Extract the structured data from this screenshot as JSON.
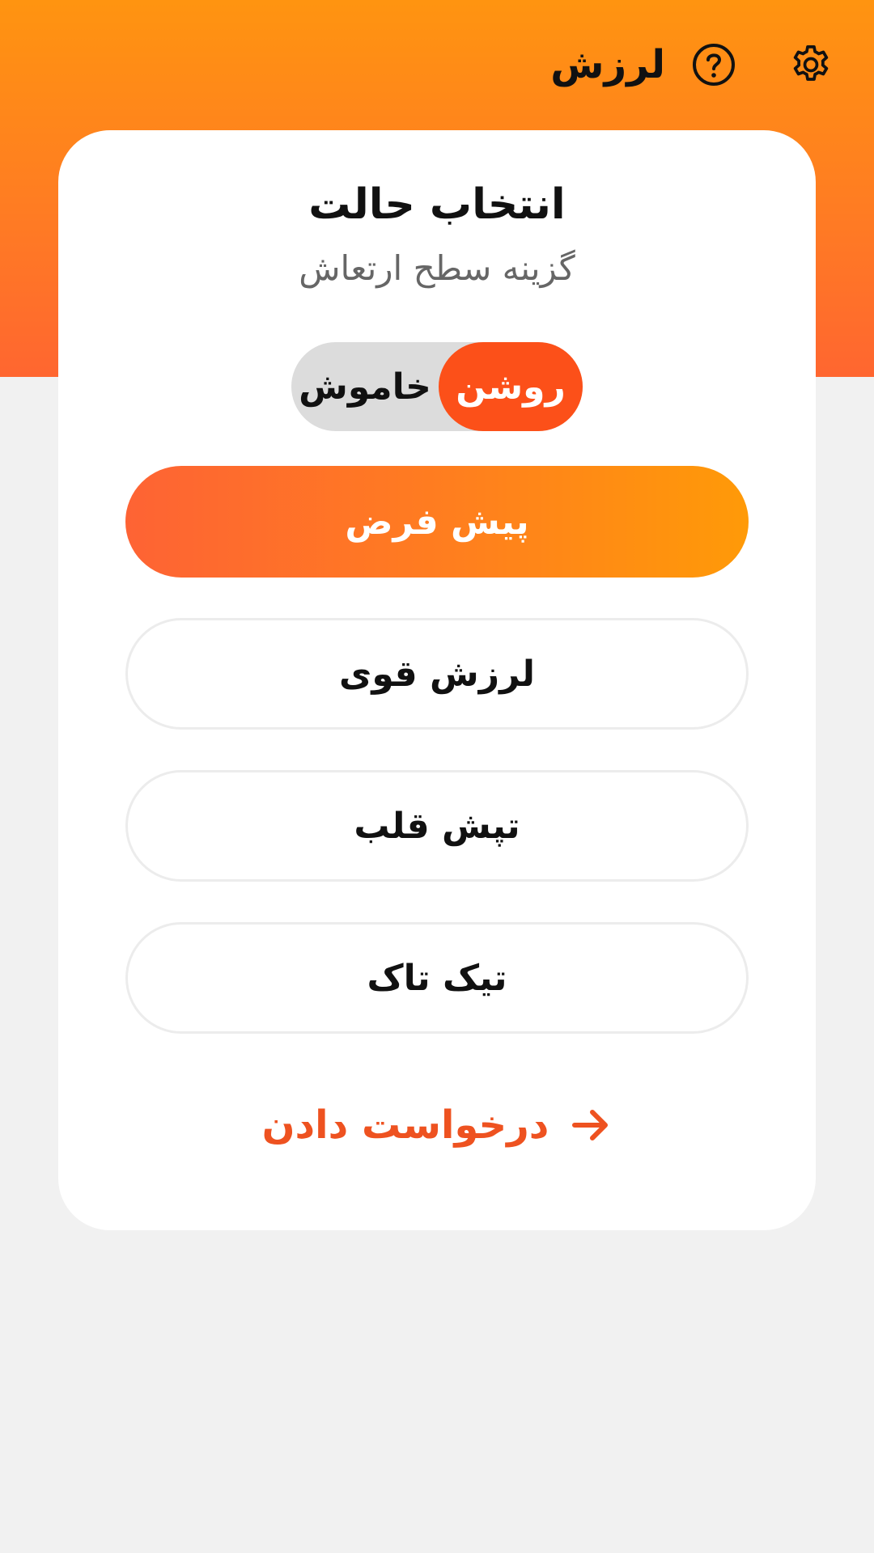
{
  "app": {
    "title": "لرزش"
  },
  "header": {
    "settings_icon": "gear-icon",
    "help_icon": "question-circle-icon"
  },
  "card": {
    "title": "انتخاب حالت",
    "subtitle": "گزینه سطح ارتعاش"
  },
  "toggle": {
    "on_label": "روشن",
    "off_label": "خاموش",
    "state": "on"
  },
  "modes": [
    {
      "label": "پیش فرض",
      "selected": true
    },
    {
      "label": "لرزش قوی",
      "selected": false
    },
    {
      "label": "تپش قلب",
      "selected": false
    },
    {
      "label": "تیک تاک",
      "selected": false
    }
  ],
  "apply": {
    "label": "درخواست دادن",
    "icon": "arrow-right-icon"
  },
  "colors": {
    "accent": "#fc5019",
    "header_gradient_top": "#ff9410",
    "header_gradient_bottom": "#ff6630",
    "apply_text": "#ee5220"
  }
}
